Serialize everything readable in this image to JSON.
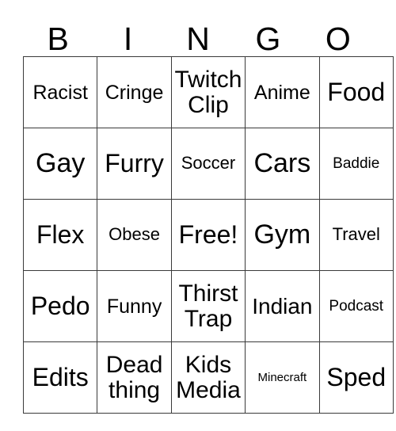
{
  "card": {
    "header_letters": [
      "B",
      "I",
      "N",
      "G",
      "O"
    ],
    "columns": [
      {
        "letter": "B",
        "cells": [
          {
            "label": "Racist",
            "size": "lg",
            "free": false
          },
          {
            "label": "Gay",
            "size": "4xl",
            "free": false
          },
          {
            "label": "Flex",
            "size": "3xl",
            "free": false
          },
          {
            "label": "Pedo",
            "size": "3xl",
            "free": false
          },
          {
            "label": "Edits",
            "size": "3xl",
            "free": false
          }
        ]
      },
      {
        "letter": "I",
        "cells": [
          {
            "label": "Cringe",
            "size": "lg",
            "free": false
          },
          {
            "label": "Furry",
            "size": "3xl",
            "free": false
          },
          {
            "label": "Obese",
            "size": "md",
            "free": false
          },
          {
            "label": "Funny",
            "size": "lg",
            "free": false
          },
          {
            "label": "Dead thing",
            "size": "2xl",
            "free": false
          }
        ]
      },
      {
        "letter": "N",
        "cells": [
          {
            "label": "Twitch Clip",
            "size": "2xl",
            "free": false
          },
          {
            "label": "Soccer",
            "size": "md",
            "free": false
          },
          {
            "label": "Free!",
            "size": "3xl",
            "free": true
          },
          {
            "label": "Thirst Trap",
            "size": "2xl",
            "free": false
          },
          {
            "label": "Kids Media",
            "size": "2xl",
            "free": false
          }
        ]
      },
      {
        "letter": "G",
        "cells": [
          {
            "label": "Anime",
            "size": "lg",
            "free": false
          },
          {
            "label": "Cars",
            "size": "4xl",
            "free": false
          },
          {
            "label": "Gym",
            "size": "4xl",
            "free": false
          },
          {
            "label": "Indian",
            "size": "xl",
            "free": false
          },
          {
            "label": "Minecraft",
            "size": "xs",
            "free": false
          }
        ]
      },
      {
        "letter": "O",
        "cells": [
          {
            "label": "Food",
            "size": "3xl",
            "free": false
          },
          {
            "label": "Baddie",
            "size": "sm",
            "free": false
          },
          {
            "label": "Travel",
            "size": "md",
            "free": false
          },
          {
            "label": "Podcast",
            "size": "sm",
            "free": false
          },
          {
            "label": "Sped",
            "size": "3xl",
            "free": false
          }
        ]
      }
    ],
    "rows": [
      [
        "Racist",
        "Cringe",
        "Twitch Clip",
        "Anime",
        "Food"
      ],
      [
        "Gay",
        "Furry",
        "Soccer",
        "Cars",
        "Baddie"
      ],
      [
        "Flex",
        "Obese",
        "Free!",
        "Gym",
        "Travel"
      ],
      [
        "Pedo",
        "Funny",
        "Thirst Trap",
        "Indian",
        "Podcast"
      ],
      [
        "Edits",
        "Dead thing",
        "Kids Media",
        "Minecraft",
        "Sped"
      ]
    ],
    "colors": {
      "background": "#ffffff",
      "text": "#000000",
      "grid_line": "#3a3a3a"
    }
  }
}
